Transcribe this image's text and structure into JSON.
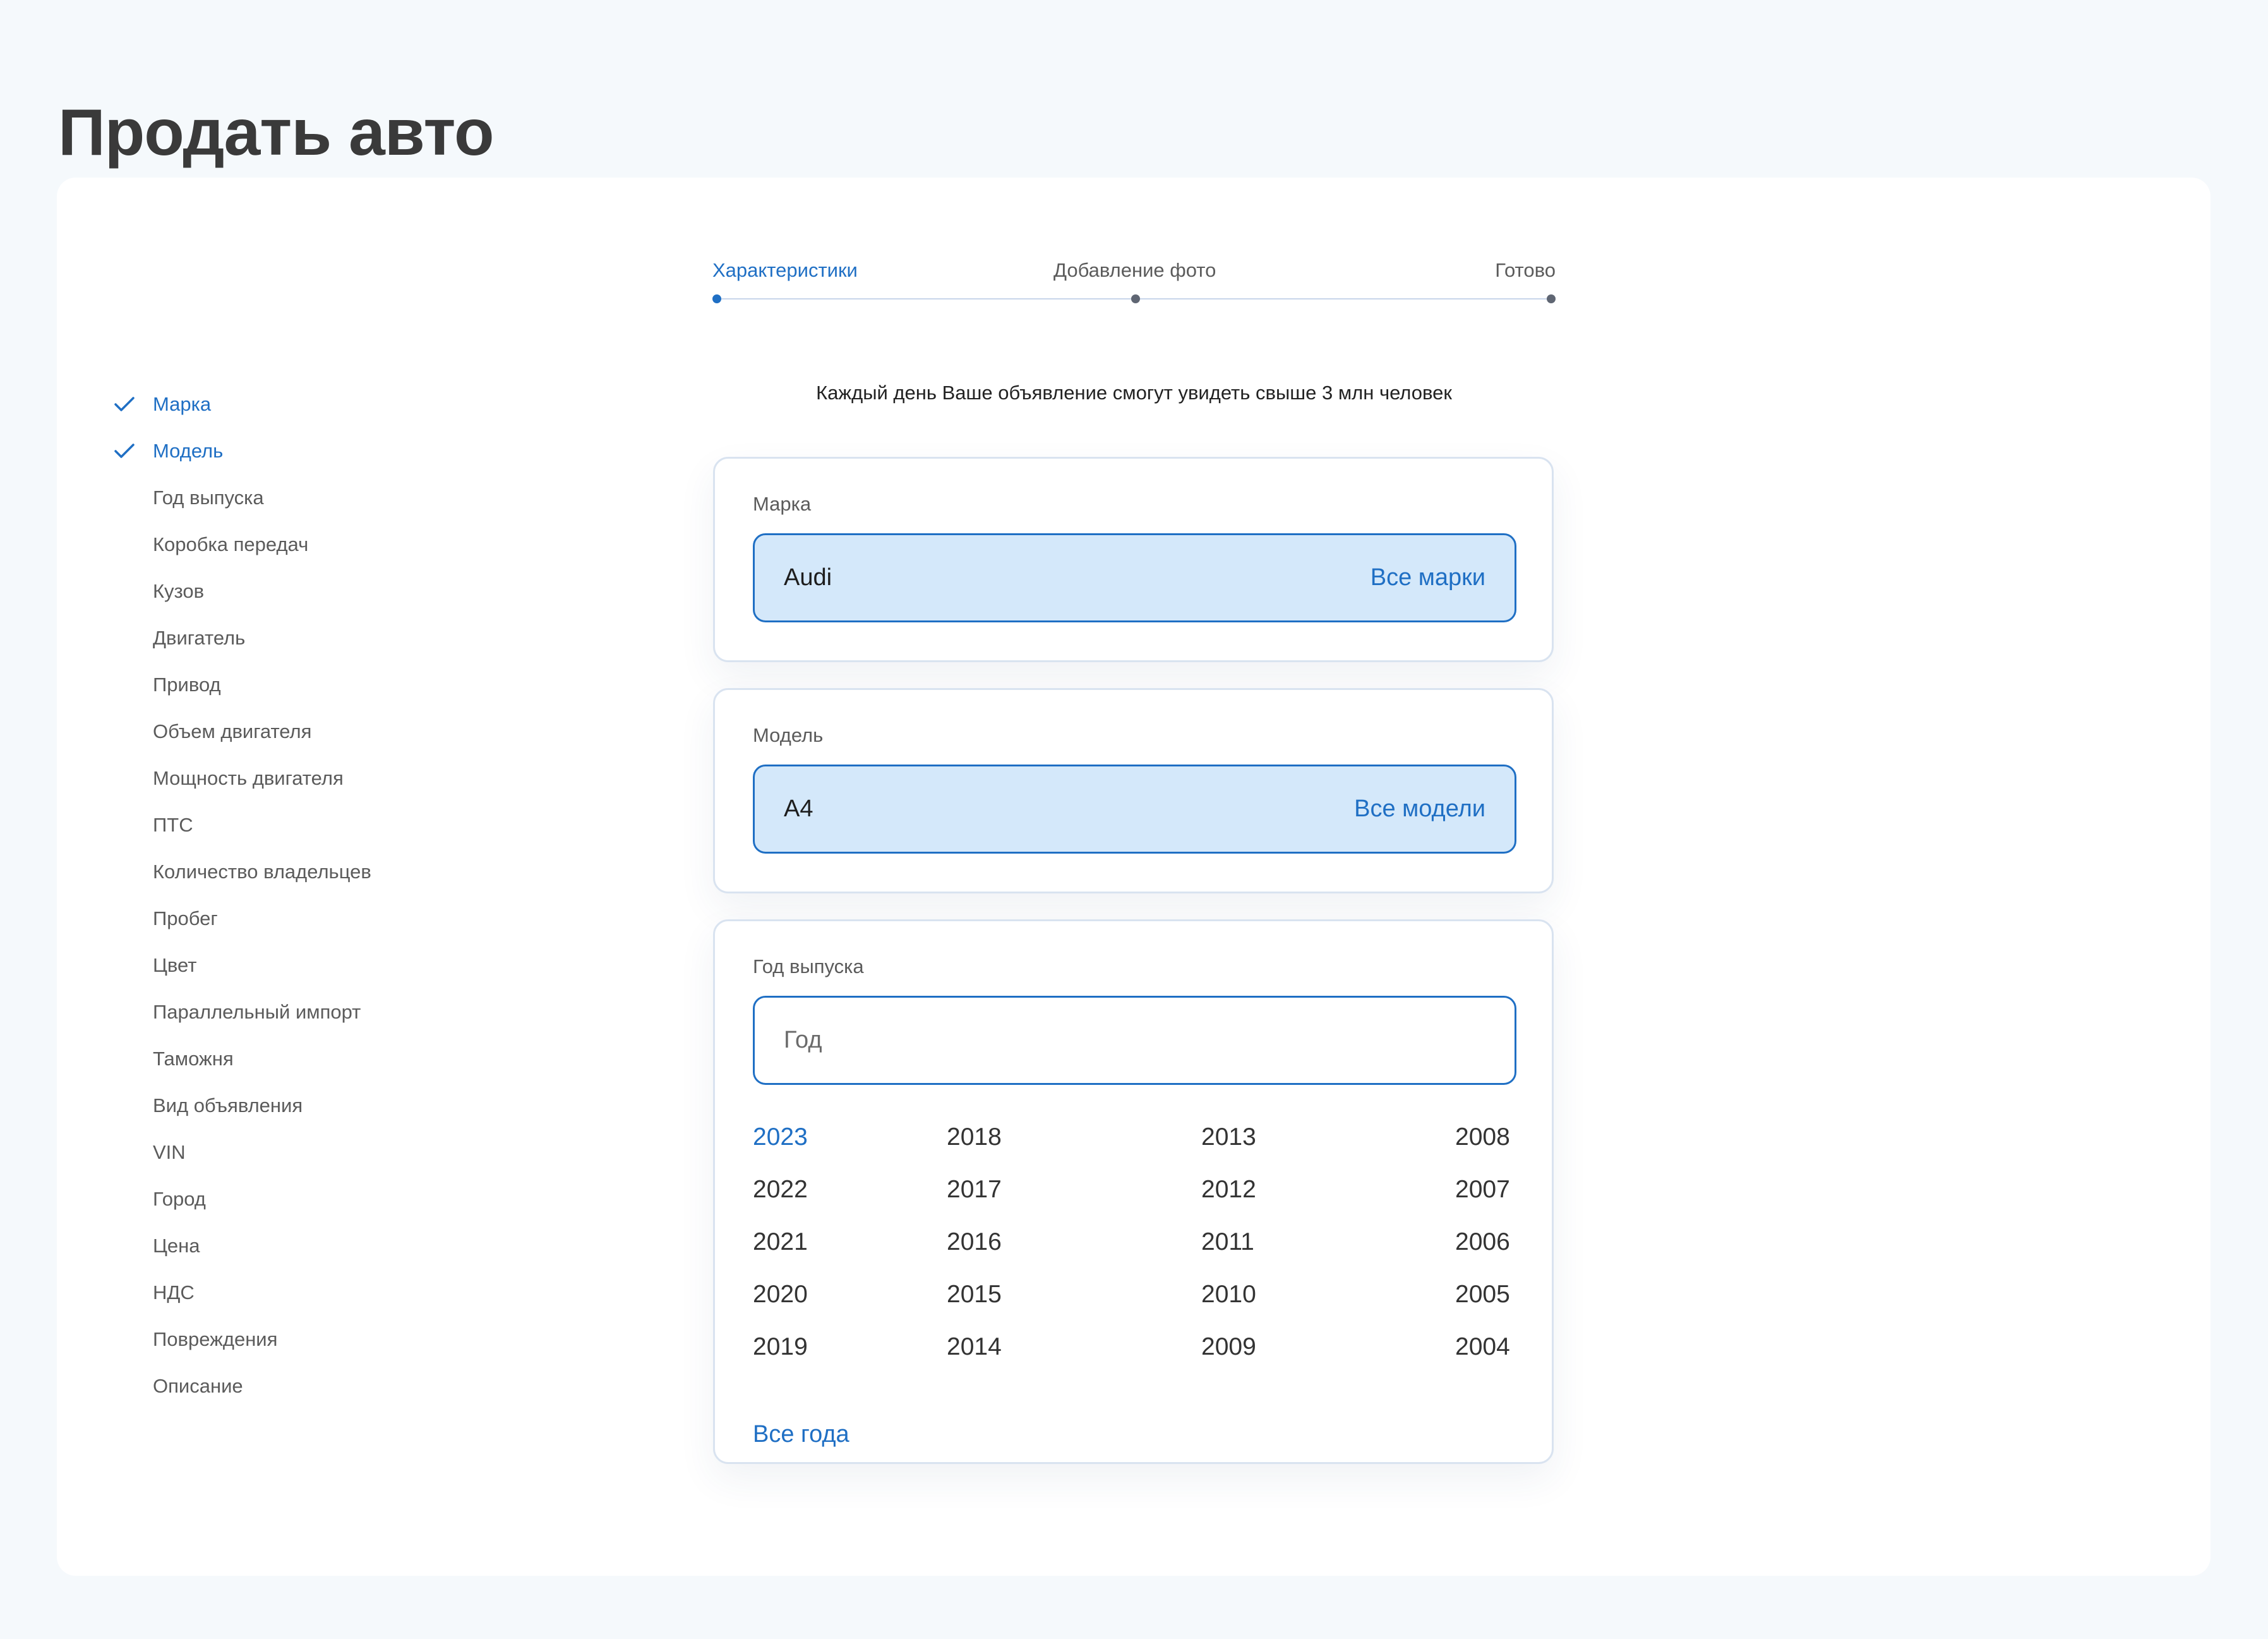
{
  "page": {
    "title": "Продать авто"
  },
  "stepper": {
    "steps": [
      {
        "label": "Характеристики",
        "active": true
      },
      {
        "label": "Добавление фото",
        "active": false
      },
      {
        "label": "Готово",
        "active": false
      }
    ]
  },
  "sidebar": {
    "items": [
      {
        "label": "Марка",
        "done": true
      },
      {
        "label": "Модель",
        "done": true
      },
      {
        "label": "Год выпуска",
        "done": false
      },
      {
        "label": "Коробка передач",
        "done": false
      },
      {
        "label": "Кузов",
        "done": false
      },
      {
        "label": "Двигатель",
        "done": false
      },
      {
        "label": "Привод",
        "done": false
      },
      {
        "label": "Объем двигателя",
        "done": false
      },
      {
        "label": "Мощность двигателя",
        "done": false
      },
      {
        "label": "ПТС",
        "done": false
      },
      {
        "label": "Количество владельцев",
        "done": false
      },
      {
        "label": "Пробег",
        "done": false
      },
      {
        "label": "Цвет",
        "done": false
      },
      {
        "label": "Параллельный импорт",
        "done": false
      },
      {
        "label": "Таможня",
        "done": false
      },
      {
        "label": "Вид объявления",
        "done": false
      },
      {
        "label": "VIN",
        "done": false
      },
      {
        "label": "Город",
        "done": false
      },
      {
        "label": "Цена",
        "done": false
      },
      {
        "label": "НДС",
        "done": false
      },
      {
        "label": "Повреждения",
        "done": false
      },
      {
        "label": "Описание",
        "done": false
      }
    ]
  },
  "info_text": "Каждый день Ваше объявление смогут увидеть свыше 3 млн человек",
  "brand": {
    "label": "Марка",
    "value": "Audi",
    "link": "Все марки"
  },
  "model": {
    "label": "Модель",
    "value": "A4",
    "link": "Все модели"
  },
  "year": {
    "label": "Год выпуска",
    "placeholder": "Год",
    "value": "",
    "options": [
      "2023",
      "2022",
      "2021",
      "2020",
      "2019",
      "2018",
      "2017",
      "2016",
      "2015",
      "2014",
      "2013",
      "2012",
      "2011",
      "2010",
      "2009",
      "2008",
      "2007",
      "2006",
      "2005",
      "2004"
    ],
    "selected": "2023",
    "all_link": "Все года"
  },
  "colors": {
    "accent": "#1f6fc4",
    "selected_fill": "#d4e8fa",
    "page_bg": "#f5f9fc",
    "border": "#d9e3f0"
  }
}
